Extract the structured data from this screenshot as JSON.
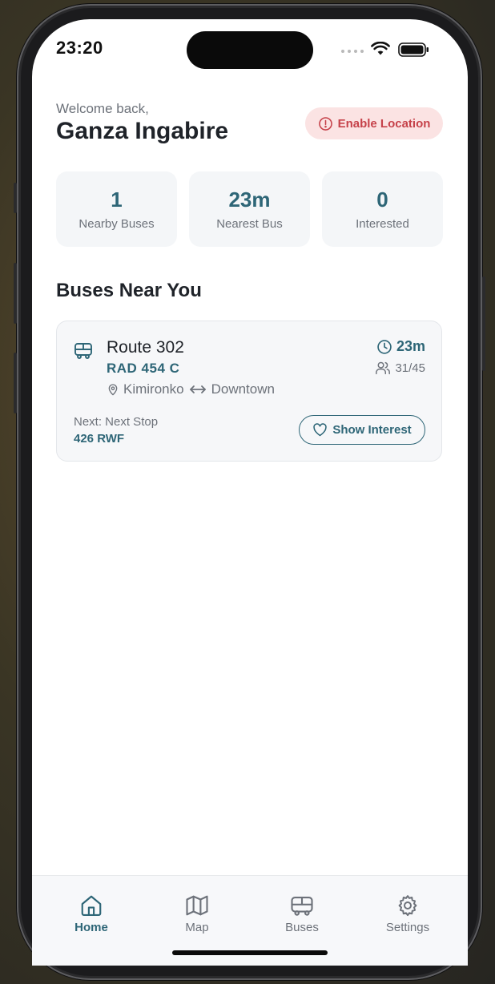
{
  "status_bar": {
    "time": "23:20"
  },
  "header": {
    "greeting": "Welcome back,",
    "user_name": "Ganza Ingabire",
    "location_button": "Enable Location"
  },
  "stats": [
    {
      "value": "1",
      "label": "Nearby Buses"
    },
    {
      "value": "23m",
      "label": "Nearest Bus"
    },
    {
      "value": "0",
      "label": "Interested"
    }
  ],
  "section_title": "Buses Near You",
  "buses": [
    {
      "route": "Route 302",
      "plate": "RAD 454 C",
      "origin": "Kimironko",
      "destination": "Downtown",
      "eta": "23m",
      "capacity": "31/45",
      "next_stop": "Next: Next Stop",
      "fare": "426 RWF",
      "action": "Show Interest"
    }
  ],
  "tabs": [
    {
      "label": "Home",
      "icon": "home-icon",
      "active": true
    },
    {
      "label": "Map",
      "icon": "map-icon",
      "active": false
    },
    {
      "label": "Buses",
      "icon": "bus-icon",
      "active": false
    },
    {
      "label": "Settings",
      "icon": "gear-icon",
      "active": false
    }
  ],
  "colors": {
    "accent": "#2e6677",
    "danger": "#c6424a",
    "danger_bg": "#fbe3e3",
    "card_bg": "#f4f6f8"
  }
}
